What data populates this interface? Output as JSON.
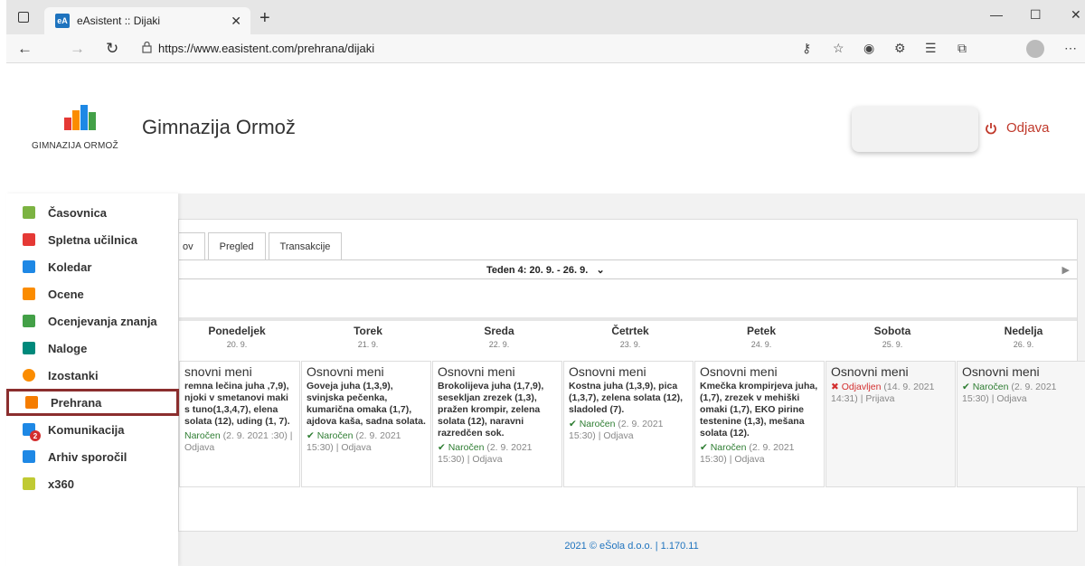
{
  "browser": {
    "tab_title": "eAsistent :: Dijaki",
    "favicon_text": "eA",
    "url": "https://www.easistent.com/prehrana/dijaki"
  },
  "header": {
    "logo_text": "GIMNAZIJA ORMOŽ",
    "school_name": "Gimnazija Ormož",
    "logout_label": "Odjava"
  },
  "sidebar": {
    "items": [
      {
        "label": "Časovnica",
        "icon": "cube-icon",
        "color": "#7cb342"
      },
      {
        "label": "Spletna učilnica",
        "icon": "x-icon",
        "color": "#e53935"
      },
      {
        "label": "Koledar",
        "icon": "calendar-icon",
        "color": "#1e88e5"
      },
      {
        "label": "Ocene",
        "icon": "grades-icon",
        "color": "#fb8c00"
      },
      {
        "label": "Ocenjevanja znanja",
        "icon": "exam-icon",
        "color": "#43a047"
      },
      {
        "label": "Naloge",
        "icon": "tasks-icon",
        "color": "#00897b"
      },
      {
        "label": "Izostanki",
        "icon": "clock-icon",
        "color": "#fb8c00"
      },
      {
        "label": "Prehrana",
        "icon": "food-icon",
        "color": "#f57c00"
      },
      {
        "label": "Komunikacija",
        "icon": "chat-icon",
        "color": "#1e88e5",
        "badge": "2"
      },
      {
        "label": "Arhiv sporočil",
        "icon": "archive-icon",
        "color": "#1e88e5"
      },
      {
        "label": "x360",
        "icon": "x360-icon",
        "color": "#c0ca33"
      }
    ]
  },
  "tabs": [
    "ov",
    "Pregled",
    "Transakcije"
  ],
  "week": "Teden 4: 20. 9. - 26. 9.",
  "days": [
    {
      "name": "Ponedeljek",
      "date": "20. 9.",
      "menu": "snovni meni",
      "desc": "remna lečina juha ,7,9), njoki v smetanovi maki s tuno(1,3,4,7), elena solata (12), uding (1, 7).",
      "status_mark": "",
      "status_text": "Naročen",
      "status_time": "(2. 9. 2021",
      "status_tail": ":30) | Odjava"
    },
    {
      "name": "Torek",
      "date": "21. 9.",
      "menu": "Osnovni meni",
      "desc": "Goveja juha (1,3,9), svinjska pečenka, kumarična omaka (1,7), ajdova kaša, sadna solata.",
      "status_mark": "✔",
      "status_text": "Naročen",
      "status_time": "(2. 9. 2021",
      "status_tail": "15:30) | Odjava"
    },
    {
      "name": "Sreda",
      "date": "22. 9.",
      "menu": "Osnovni meni",
      "desc": "Brokolijeva juha (1,7,9), sesekljan zrezek (1,3), pražen krompir, zelena solata (12), naravni razredčen sok.",
      "status_mark": "✔",
      "status_text": "Naročen",
      "status_time": "(2. 9. 2021",
      "status_tail": "15:30) | Odjava"
    },
    {
      "name": "Četrtek",
      "date": "23. 9.",
      "menu": "Osnovni meni",
      "desc": "Kostna juha (1,3,9), pica (1,3,7), zelena solata (12), sladoled (7).",
      "status_mark": "✔",
      "status_text": "Naročen",
      "status_time": "(2. 9. 2021",
      "status_tail": "15:30) | Odjava"
    },
    {
      "name": "Petek",
      "date": "24. 9.",
      "menu": "Osnovni meni",
      "desc": "Kmečka krompirjeva juha, (1,7), zrezek v mehiški omaki (1,7), EKO pirine testenine (1,3), mešana solata (12).",
      "status_mark": "✔",
      "status_text": "Naročen",
      "status_time": "(2. 9. 2021",
      "status_tail": "15:30) | Odjava"
    },
    {
      "name": "Sobota",
      "date": "25. 9.",
      "menu": "Osnovni meni",
      "desc": "",
      "status_mark": "✖",
      "status_text": "Odjavljen",
      "status_time": "(14. 9. 2021",
      "status_tail": "14:31) | Prijava"
    },
    {
      "name": "Nedelja",
      "date": "26. 9.",
      "menu": "Osnovni meni",
      "desc": "",
      "status_mark": "✔",
      "status_text": "Naročen",
      "status_time": "(2. 9. 2021",
      "status_tail": "15:30) | Odjava"
    }
  ],
  "footer": "2021 © eŠola d.o.o.   |   1.170.11"
}
